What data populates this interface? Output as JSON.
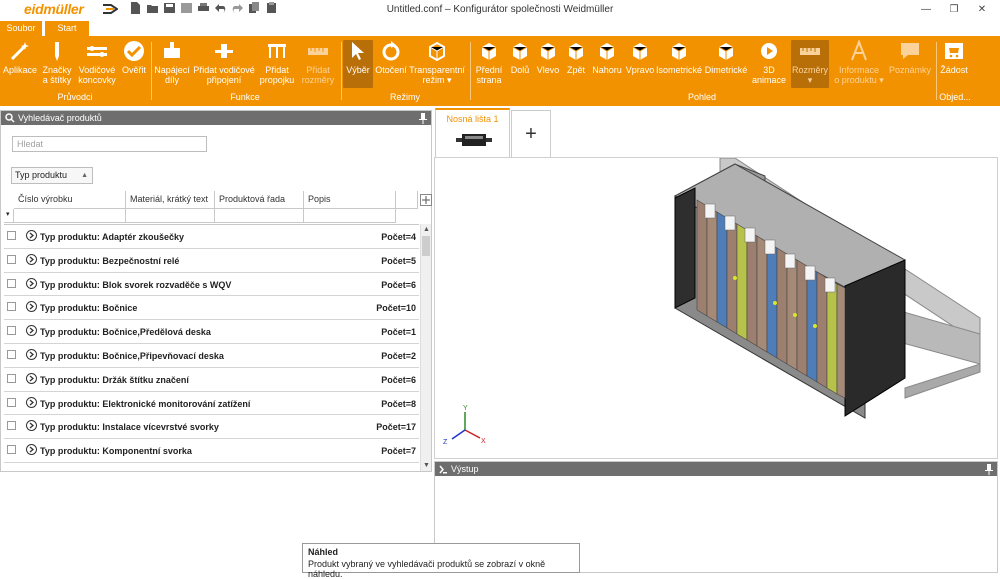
{
  "app": {
    "logo_text": "eidmüller",
    "window_title": "Untitled.conf – Konfigurátor společnosti Weidmüller",
    "minimize_glyph": "—",
    "maximize_glyph": "❐",
    "close_glyph": "✕"
  },
  "tabs": {
    "file": "Soubor",
    "start": "Start"
  },
  "ribbon": {
    "groups": {
      "pruvodci": "Průvodci",
      "funkce": "Funkce",
      "rezimy": "Režimy",
      "pohled": "Pohled",
      "objednavka": "Objed..."
    },
    "buttons": {
      "aplikace": "Aplikace",
      "znacky_l1": "Značky",
      "znacky_l2": "a štítky",
      "vodicove_l1": "Vodičové",
      "vodicove_l2": "koncovky",
      "overit": "Ověřit",
      "napajeci_l1": "Napájecí",
      "napajeci_l2": "díly",
      "pridat_vodic_l1": "Přidat vodičové",
      "pridat_vodic_l2": "připojení",
      "pridat_propojku_l1": "Přidat",
      "pridat_propojku_l2": "propojku",
      "pridat_rozmery_l1": "Přidat",
      "pridat_rozmery_l2": "rozměry",
      "vyber": "Výběr",
      "otoceni": "Otočení",
      "transparentni_l1": "Transparentní",
      "transparentni_l2": "režim ▾",
      "predni_l1": "Přední",
      "predni_l2": "strana",
      "dolu": "Dolů",
      "vlevo": "Vlevo",
      "zpet": "Zpět",
      "nahoru": "Nahoru",
      "vpravo": "Vpravo",
      "izometricke": "Isometrické",
      "dimetricke": "Dimetrické",
      "animace_l1": "3D",
      "animace_l2": "animace",
      "rozmery_l1": "Rozměry",
      "rozmery_l2": "▾",
      "informace_l1": "Informace",
      "informace_l2": "o produktu ▾",
      "poznamky": "Poznámky",
      "zadost": "Žádost"
    }
  },
  "left_panel": {
    "title": "Vyhledávač produktů",
    "search_placeholder": "Hledat",
    "filter_label": "Typ produktu",
    "columns": [
      "Číslo výrobku",
      "Materiál, krátký text",
      "Produktová řada",
      "Popis"
    ],
    "rows": [
      {
        "label": "Typ produktu: Adaptér zkoušečky",
        "count": "Počet=4"
      },
      {
        "label": "Typ produktu: Bezpečnostní relé",
        "count": "Počet=5"
      },
      {
        "label": "Typ produktu: Blok svorek rozvaděče s WQV",
        "count": "Počet=6"
      },
      {
        "label": "Typ produktu: Bočnice",
        "count": "Počet=10"
      },
      {
        "label": "Typ produktu: Bočnice,Předělová deska",
        "count": "Počet=1"
      },
      {
        "label": "Typ produktu: Bočnice,Připevňovací deska",
        "count": "Počet=2"
      },
      {
        "label": "Typ produktu: Držák štítku značení",
        "count": "Počet=6"
      },
      {
        "label": "Typ produktu: Elektronické monitorování zatížení",
        "count": "Počet=8"
      },
      {
        "label": "Typ produktu: Instalace vícevrstvé svorky",
        "count": "Počet=17"
      },
      {
        "label": "Typ produktu: Komponentní svorka",
        "count": "Počet=7"
      }
    ]
  },
  "document_tab": {
    "label": "Nosná lišta 1",
    "add": "+"
  },
  "axes": {
    "x": "X",
    "y": "Y",
    "z": "Z"
  },
  "output_panel": {
    "title": "Výstup"
  },
  "tooltip": {
    "title": "Náhled",
    "text": "Produkt vybraný ve vyhledávači produktů se zobrazí v okně náhledu."
  },
  "colors": {
    "accent": "#f39200",
    "panel_header": "#6e6e6e"
  }
}
